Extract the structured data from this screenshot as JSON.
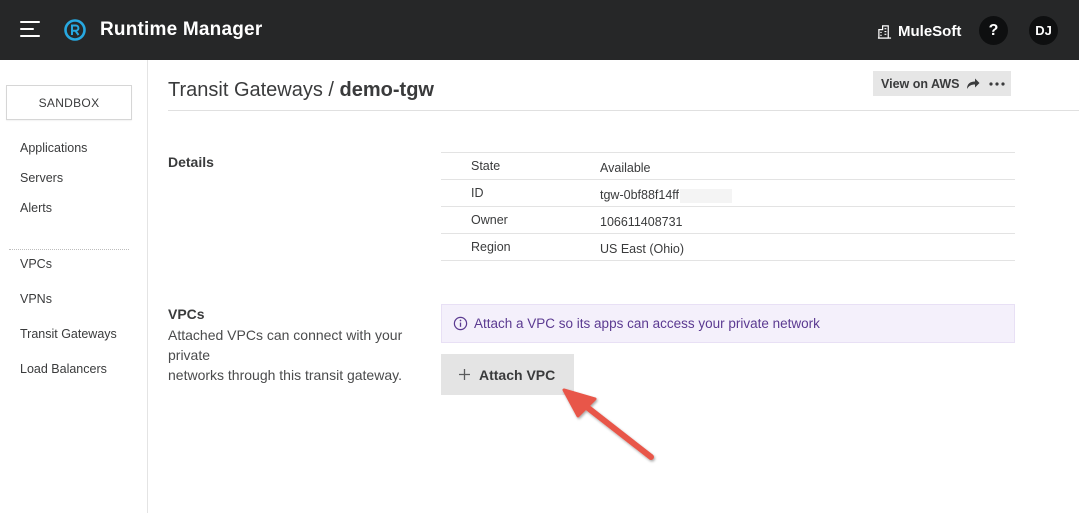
{
  "header": {
    "app_title": "Runtime Manager",
    "brand": "MuleSoft",
    "help_label": "?",
    "user_initials": "DJ"
  },
  "sidebar": {
    "environment": "SANDBOX",
    "items": [
      {
        "label": "Applications"
      },
      {
        "label": "Servers"
      },
      {
        "label": "Alerts"
      },
      {
        "label": "VPCs"
      },
      {
        "label": "VPNs"
      },
      {
        "label": "Transit Gateways"
      },
      {
        "label": "Load Balancers"
      }
    ]
  },
  "main": {
    "breadcrumb_parent": "Transit Gateways",
    "breadcrumb_separator": " / ",
    "current": "demo-tgw",
    "view_on_aws_label": "View on AWS",
    "details": {
      "heading": "Details",
      "rows": [
        {
          "key": "State",
          "value": "Available"
        },
        {
          "key": "ID",
          "value": "tgw-0bf88f14ff"
        },
        {
          "key": "Owner",
          "value": "106611408731"
        },
        {
          "key": "Region",
          "value": "US East (Ohio)"
        }
      ]
    },
    "vpcs": {
      "heading": "VPCs",
      "description_line1": "Attached VPCs can connect with your",
      "description_line2": "private",
      "description_line3": "networks through this transit gateway.",
      "info_banner": "Attach a VPC so its apps can access your private network",
      "attach_button_label": "Attach VPC"
    }
  },
  "icons": {
    "menu": "hamburger-menu-icon",
    "logo": "runtime-manager-logo",
    "brand": "mulesoft-building-icon",
    "share": "share-arrow-icon",
    "more": "more-horizontal-icon",
    "info": "info-circle-icon",
    "plus": "plus-icon",
    "annotation": "red-annotation-arrow"
  },
  "colors": {
    "topbar_bg": "#262728",
    "logo_accent": "#27a8e0",
    "info_banner_bg": "#f4f0fb",
    "info_text": "#5b3a91",
    "annotation_arrow": "#e8574a"
  }
}
